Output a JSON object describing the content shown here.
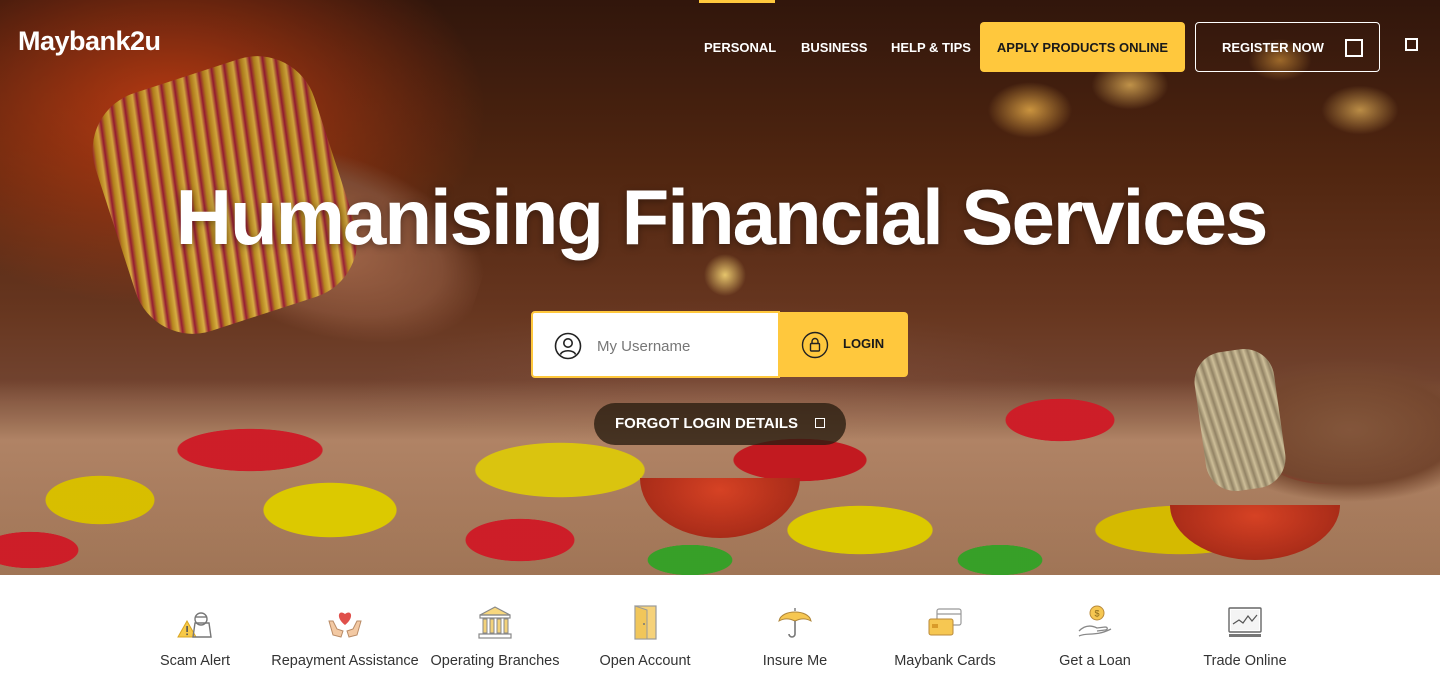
{
  "brand": {
    "logo_text": "Maybank2u",
    "accent_color": "#ffc83d"
  },
  "nav": {
    "links": [
      "PERSONAL",
      "BUSINESS",
      "HELP & TIPS"
    ],
    "active": "PERSONAL",
    "apply_label": "APPLY PRODUCTS ONLINE",
    "register_label": "REGISTER NOW"
  },
  "hero": {
    "headline": "Humanising Financial Services"
  },
  "login": {
    "username_placeholder": "My Username",
    "login_label": "LOGIN",
    "forgot_label": "FORGOT LOGIN DETAILS"
  },
  "quick_links": [
    {
      "label": "Scam Alert",
      "icon": "scam-alert-icon"
    },
    {
      "label": "Repayment Assistance",
      "icon": "heart-hands-icon"
    },
    {
      "label": "Operating Branches",
      "icon": "bank-building-icon"
    },
    {
      "label": "Open Account",
      "icon": "door-icon"
    },
    {
      "label": "Insure Me",
      "icon": "umbrella-icon"
    },
    {
      "label": "Maybank Cards",
      "icon": "cards-icon"
    },
    {
      "label": "Get a Loan",
      "icon": "coin-hand-icon"
    },
    {
      "label": "Trade Online",
      "icon": "monitor-chart-icon"
    }
  ]
}
